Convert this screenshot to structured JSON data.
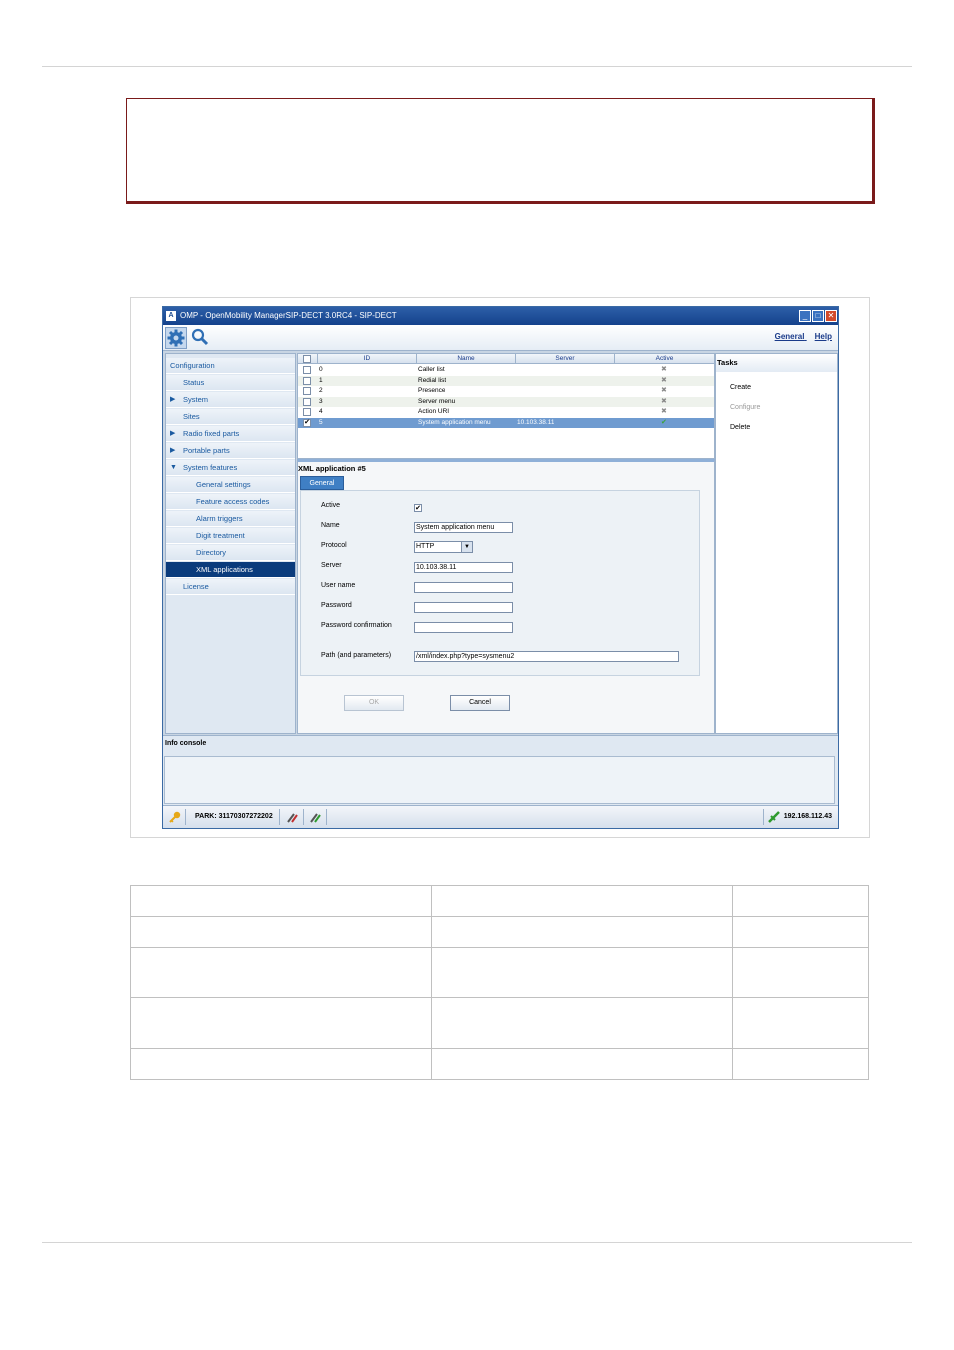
{
  "window": {
    "title": "OMP - OpenMobility ManagerSIP-DECT 3.0RC4 - SIP-DECT",
    "app_icon": "A",
    "minimize_label": "_",
    "maximize_label": "□",
    "close_label": "✕"
  },
  "toolbar": {
    "icons": [
      "gear-icon",
      "search-icon"
    ],
    "general_link": "General",
    "help_link": "Help"
  },
  "sidebar": {
    "items": [
      {
        "label": "Configuration"
      },
      {
        "label": "Status"
      },
      {
        "label": "System"
      },
      {
        "label": "Sites"
      },
      {
        "label": "Radio fixed parts"
      },
      {
        "label": "Portable parts"
      },
      {
        "label": "System features"
      },
      {
        "label": "General settings"
      },
      {
        "label": "Feature access codes"
      },
      {
        "label": "Alarm triggers"
      },
      {
        "label": "Digit treatment"
      },
      {
        "label": "Directory"
      },
      {
        "label": "XML applications"
      },
      {
        "label": "License"
      }
    ]
  },
  "table": {
    "headers": {
      "id": "ID",
      "name": "Name",
      "server": "Server",
      "active": "Active"
    },
    "rows": [
      {
        "id": "0",
        "name": "Caller list",
        "server": "",
        "active": "✖"
      },
      {
        "id": "1",
        "name": "Redial list",
        "server": "",
        "active": "✖"
      },
      {
        "id": "2",
        "name": "Presence",
        "server": "",
        "active": "✖"
      },
      {
        "id": "3",
        "name": "Server menu",
        "server": "",
        "active": "✖"
      },
      {
        "id": "4",
        "name": "Action URI",
        "server": "",
        "active": "✖"
      },
      {
        "id": "5",
        "name": "System application menu",
        "server": "10.103.38.11",
        "active": "✔"
      }
    ],
    "check_mark": "✔"
  },
  "tasks": {
    "title": "Tasks",
    "create": "Create",
    "configure": "Configure",
    "delete": "Delete"
  },
  "detail": {
    "title": "XML application #5",
    "tab": "General",
    "fields": {
      "active_label": "Active",
      "active_check": "✔",
      "name_label": "Name",
      "name_value": "System application menu",
      "protocol_label": "Protocol",
      "protocol_value": "HTTP",
      "protocol_arrow": "▼",
      "server_label": "Server",
      "server_value": "10.103.38.11",
      "username_label": "User name",
      "username_value": "",
      "password_label": "Password",
      "password_value": "",
      "password_confirm_label": "Password confirmation",
      "password_confirm_value": "",
      "path_label": "Path (and parameters)",
      "path_value": "/xml/index.php?type=sysmenu2"
    },
    "ok_label": "OK",
    "cancel_label": "Cancel"
  },
  "console": {
    "title": "Info console"
  },
  "statusbar": {
    "park": "PARK: 31170307272202",
    "ip": "192.168.112.43"
  },
  "colors": {
    "title_bar": "#1d4f98",
    "selected": "#0a3b7c",
    "note_border": "#7a1a1a"
  }
}
